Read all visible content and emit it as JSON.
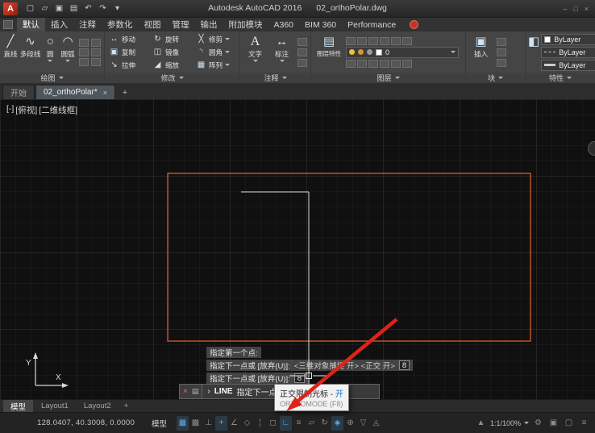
{
  "window": {
    "logo_letter": "A",
    "title_product": "Autodesk AutoCAD 2016",
    "title_doc": "02_orthoPolar.dwg",
    "controls": [
      {
        "name": "minimize",
        "glyph": "–"
      },
      {
        "name": "maximize",
        "glyph": "□"
      },
      {
        "name": "close",
        "glyph": "×"
      }
    ]
  },
  "quick_access": [
    {
      "name": "qat-new",
      "glyph": "▢"
    },
    {
      "name": "qat-open",
      "glyph": "▱"
    },
    {
      "name": "qat-save",
      "glyph": "▣"
    },
    {
      "name": "qat-plot",
      "glyph": "▤"
    },
    {
      "name": "qat-undo",
      "glyph": "↶"
    },
    {
      "name": "qat-redo",
      "glyph": "↷"
    },
    {
      "name": "qat-dropdown",
      "glyph": "▾"
    }
  ],
  "ribbon_tabs": [
    {
      "label": "默认"
    },
    {
      "label": "插入"
    },
    {
      "label": "注释"
    },
    {
      "label": "参数化"
    },
    {
      "label": "视图"
    },
    {
      "label": "管理"
    },
    {
      "label": "输出"
    },
    {
      "label": "附加模块"
    },
    {
      "label": "A360"
    },
    {
      "label": "BIM 360"
    },
    {
      "label": "Performance"
    }
  ],
  "ribbon": {
    "draw": {
      "title": "绘图",
      "tools": [
        {
          "label": "直线",
          "glyph": "╱"
        },
        {
          "label": "多段线",
          "glyph": "∿"
        },
        {
          "label": "圆",
          "glyph": "○"
        },
        {
          "label": "圆弧",
          "glyph": "◠"
        }
      ]
    },
    "modify": {
      "title": "修改",
      "tools": [
        {
          "label": "移动",
          "glyph": "↔"
        },
        {
          "label": "旋转",
          "glyph": "↻"
        },
        {
          "label": "修剪",
          "glyph": "╳"
        },
        {
          "label": "复制",
          "glyph": "▣"
        },
        {
          "label": "镜像",
          "glyph": "◫"
        },
        {
          "label": "圆角",
          "glyph": "◝"
        },
        {
          "label": "拉伸",
          "glyph": "↘"
        },
        {
          "label": "缩放",
          "glyph": "◢"
        },
        {
          "label": "阵列",
          "glyph": "▦"
        }
      ]
    },
    "annotate": {
      "title": "注释",
      "text_tool": {
        "label": "文字",
        "glyph": "A"
      },
      "dim_tool": {
        "label": "标注",
        "glyph": "↔"
      }
    },
    "layers": {
      "title": "图层",
      "properties_label": "图层特性",
      "glyph": "▤",
      "layer_value": "0"
    },
    "block": {
      "title": "块",
      "insert_label": "插入",
      "glyph": "▣"
    },
    "properties": {
      "title": "特性",
      "glyph": "◧",
      "rows": [
        "ByLayer",
        "ByLayer",
        "ByLayer"
      ]
    }
  },
  "file_tabs": {
    "start": "开始",
    "doc": "02_orthoPolar*",
    "close_glyph": "×",
    "add_glyph": "+"
  },
  "viewport": {
    "controls": [
      "[-]",
      "[俯视]",
      "[二维线框]"
    ]
  },
  "prompts": {
    "line1": "指定第一个点:",
    "line2_label": "指定下一点或 [放弃(U)]:",
    "line2_hint": "<三维对象捕捉 开> <正交 开>",
    "line2_value": "8",
    "line3_label": "指定下一点或 [放弃(U)]:",
    "line3_value": "8"
  },
  "command_bar": {
    "close_glyph": "×",
    "menu_glyph": "▤",
    "prompt_glyph": "›",
    "command": "LINE",
    "prompt": "指定下一点或 [放弃(U)]:"
  },
  "tooltip": {
    "title": "正交限制光标 - ",
    "state": "开",
    "subtitle": "ORTHOMODE (F8)"
  },
  "layout_tabs": {
    "model": "模型",
    "layout1": "Layout1",
    "layout2": "Layout2",
    "add": "+"
  },
  "status_bar": {
    "coordinates": "128.0407, 40.3008, 0.0000",
    "model_badge": "模型",
    "zoom": "1:1/100%",
    "icons": [
      {
        "name": "grid-toggle",
        "glyph": "▦",
        "active": true
      },
      {
        "name": "snap-toggle",
        "glyph": "▩",
        "active": false
      },
      {
        "name": "infer-constraints-toggle",
        "glyph": "⊥",
        "active": false
      },
      {
        "name": "dynamic-input-toggle",
        "glyph": "+",
        "active": true
      },
      {
        "name": "polar-tracking-toggle",
        "glyph": "∠",
        "active": false
      },
      {
        "name": "isometric-toggle",
        "glyph": "◇",
        "active": false
      },
      {
        "name": "object-snap-tracking-toggle",
        "glyph": "¦",
        "active": false
      },
      {
        "name": "object-snap-toggle",
        "glyph": "◻",
        "active": false
      },
      {
        "name": "ortho-toggle",
        "glyph": "∟",
        "active": true
      },
      {
        "name": "lineweight-toggle",
        "glyph": "≡",
        "active": false
      },
      {
        "name": "transparency-toggle",
        "glyph": "▱",
        "active": false
      },
      {
        "name": "selection-cycling-toggle",
        "glyph": "↻",
        "active": false
      },
      {
        "name": "osnap-3d-toggle",
        "glyph": "◈",
        "active": true
      },
      {
        "name": "dynamic-ucs-toggle",
        "glyph": "⊕",
        "active": false
      },
      {
        "name": "selection-filter-toggle",
        "glyph": "▽",
        "active": false
      },
      {
        "name": "gizmo-toggle",
        "glyph": "◬",
        "active": false
      }
    ],
    "right_icons": [
      {
        "name": "annotation-visibility-icon",
        "glyph": "▲"
      },
      {
        "name": "workspace-gear-icon",
        "glyph": "⚙"
      },
      {
        "name": "annotation-monitor-icon",
        "glyph": "▣"
      },
      {
        "name": "clean-screen-icon",
        "glyph": "▢"
      },
      {
        "name": "customize-icon",
        "glyph": "≡"
      }
    ]
  },
  "colors": {
    "rectangle_stroke": "#d2622a",
    "arrow_red": "#df2318",
    "ortho_active": "#59b0ea",
    "canvas_bg": "#101010"
  }
}
